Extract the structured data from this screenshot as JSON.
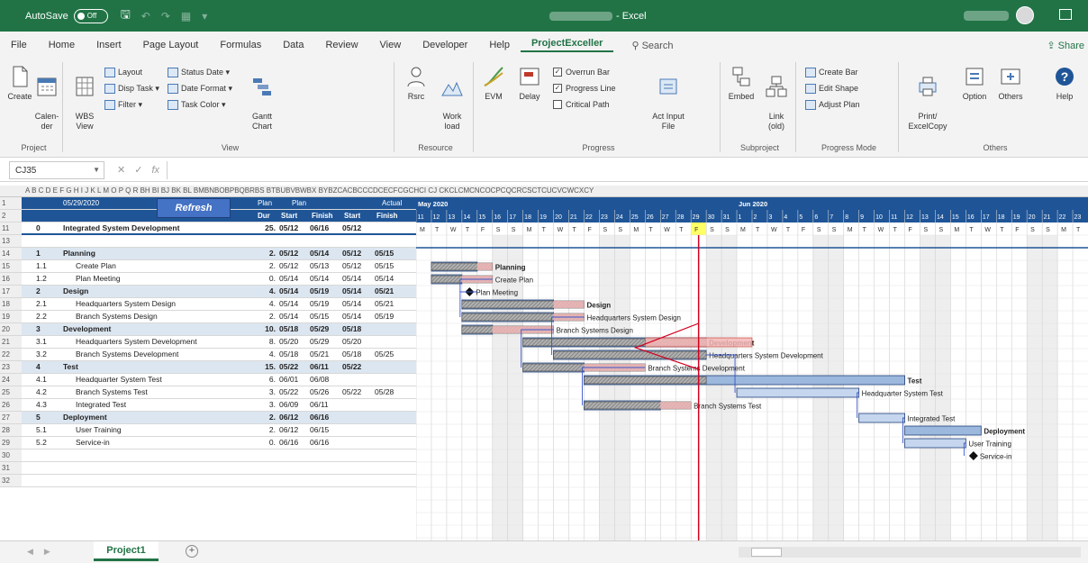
{
  "titlebar": {
    "autosave_label": "AutoSave",
    "autosave_state": "Off",
    "app_name": "- Excel"
  },
  "tabs": [
    "File",
    "Home",
    "Insert",
    "Page Layout",
    "Formulas",
    "Data",
    "Review",
    "View",
    "Developer",
    "Help",
    "ProjectExceller"
  ],
  "active_tab": "ProjectExceller",
  "search_label": "Search",
  "share_label": "Share",
  "ribbon": {
    "project": {
      "label": "Project",
      "create": "Create",
      "calendar": "Calen-\nder"
    },
    "view": {
      "label": "View",
      "wbs": "WBS\nView",
      "layout": "Layout",
      "disp_task": "Disp Task",
      "filter": "Filter",
      "status_date": "Status Date",
      "date_format": "Date Format",
      "task_color": "Task Color",
      "gantt_chart": "Gantt\nChart"
    },
    "resource": {
      "label": "Resource",
      "rsrc": "Rsrc",
      "work_load": "Work\nload"
    },
    "progress": {
      "label": "Progress",
      "evm": "EVM",
      "delay": "Delay",
      "overrun_bar": "Overrun Bar",
      "progress_line": "Progress Line",
      "critical_path": "Critical Path",
      "act_input_file": "Act Input\nFile"
    },
    "subproject": {
      "label": "Subproject",
      "embed": "Embed",
      "link": "Link\n(old)"
    },
    "progress_mode": {
      "label": "Progress Mode",
      "create_bar": "Create Bar",
      "edit_shape": "Edit Shape",
      "adjust_plan": "Adjust Plan"
    },
    "others": {
      "label": "Others",
      "print": "Print/\nExcelCopy",
      "option": "Option",
      "others_btn": "Others",
      "help": "Help"
    }
  },
  "formula_bar": {
    "cell_ref": "CJ35",
    "fx": "fx"
  },
  "sheet": {
    "col_headers": "A  B  C D E F G H I J  K          L                        M      O       P       Q       R   BH BI BJ BK BL BMBNBOBPBQBRBS BTBUBVBWBX BYBZCACBCCCDCECFCGCHCI CJ CKCLCMCNCOCPCQCRCSCTCUCVCWCXCY",
    "row_numbers": [
      "1",
      "2",
      "11",
      "13",
      "14",
      "15",
      "16",
      "17",
      "18",
      "19",
      "20",
      "21",
      "22",
      "23",
      "24",
      "25",
      "26",
      "27",
      "28",
      "29",
      "30",
      "31",
      "32"
    ],
    "header": {
      "status_date": "05/29/2020",
      "refresh": "Refresh",
      "plan": "Plan",
      "dur": "Dur",
      "plan_group": "Plan",
      "actual_group": "Actual",
      "start": "Start",
      "finish": "Finish",
      "month1": "May 2020",
      "month2": "Jun 2020"
    },
    "rows": [
      {
        "wbs": "0",
        "task": "Integrated System Development",
        "dur": "25.",
        "ps": "05/12",
        "pf": "06/16",
        "as": "05/12",
        "af": "",
        "kind": "summary"
      },
      {
        "wbs": "",
        "task": "",
        "dur": "",
        "ps": "",
        "pf": "",
        "as": "",
        "af": "",
        "kind": "blank"
      },
      {
        "wbs": "1",
        "task": "Planning",
        "dur": "2.",
        "ps": "05/12",
        "pf": "05/14",
        "as": "05/12",
        "af": "05/15",
        "kind": "lvl1"
      },
      {
        "wbs": "1.1",
        "task": "Create Plan",
        "dur": "2.",
        "ps": "05/12",
        "pf": "05/13",
        "as": "05/12",
        "af": "05/15",
        "kind": "task"
      },
      {
        "wbs": "1.2",
        "task": "Plan Meeting",
        "dur": "0.",
        "ps": "05/14",
        "pf": "05/14",
        "as": "05/14",
        "af": "05/14",
        "kind": "task"
      },
      {
        "wbs": "2",
        "task": "Design",
        "dur": "4.",
        "ps": "05/14",
        "pf": "05/19",
        "as": "05/14",
        "af": "05/21",
        "kind": "lvl1"
      },
      {
        "wbs": "2.1",
        "task": "Headquarters System Design",
        "dur": "4.",
        "ps": "05/14",
        "pf": "05/19",
        "as": "05/14",
        "af": "05/21",
        "kind": "task"
      },
      {
        "wbs": "2.2",
        "task": "Branch Systems Design",
        "dur": "2.",
        "ps": "05/14",
        "pf": "05/15",
        "as": "05/14",
        "af": "05/19",
        "kind": "task"
      },
      {
        "wbs": "3",
        "task": "Development",
        "dur": "10.",
        "ps": "05/18",
        "pf": "05/29",
        "as": "05/18",
        "af": "",
        "kind": "lvl1"
      },
      {
        "wbs": "3.1",
        "task": "Headquarters System Development",
        "dur": "8.",
        "ps": "05/20",
        "pf": "05/29",
        "as": "05/20",
        "af": "",
        "kind": "task"
      },
      {
        "wbs": "3.2",
        "task": "Branch Systems Development",
        "dur": "4.",
        "ps": "05/18",
        "pf": "05/21",
        "as": "05/18",
        "af": "05/25",
        "kind": "task"
      },
      {
        "wbs": "4",
        "task": "Test",
        "dur": "15.",
        "ps": "05/22",
        "pf": "06/11",
        "as": "05/22",
        "af": "",
        "kind": "lvl1"
      },
      {
        "wbs": "4.1",
        "task": "Headquarter System Test",
        "dur": "6.",
        "ps": "06/01",
        "pf": "06/08",
        "as": "",
        "af": "",
        "kind": "task"
      },
      {
        "wbs": "4.2",
        "task": "Branch Systems Test",
        "dur": "3.",
        "ps": "05/22",
        "pf": "05/26",
        "as": "05/22",
        "af": "05/28",
        "kind": "task"
      },
      {
        "wbs": "4.3",
        "task": "Integrated Test",
        "dur": "3.",
        "ps": "06/09",
        "pf": "06/11",
        "as": "",
        "af": "",
        "kind": "task"
      },
      {
        "wbs": "5",
        "task": "Deployment",
        "dur": "2.",
        "ps": "06/12",
        "pf": "06/16",
        "as": "",
        "af": "",
        "kind": "lvl1"
      },
      {
        "wbs": "5.1",
        "task": "User Training",
        "dur": "2.",
        "ps": "06/12",
        "pf": "06/15",
        "as": "",
        "af": "",
        "kind": "task"
      },
      {
        "wbs": "5.2",
        "task": "Service-in",
        "dur": "0.",
        "ps": "06/16",
        "pf": "06/16",
        "as": "",
        "af": "",
        "kind": "task"
      },
      {
        "wbs": "",
        "task": "",
        "dur": "",
        "ps": "",
        "pf": "",
        "as": "",
        "af": "",
        "kind": "blank"
      },
      {
        "wbs": "",
        "task": "",
        "dur": "",
        "ps": "",
        "pf": "",
        "as": "",
        "af": "",
        "kind": "blank"
      },
      {
        "wbs": "",
        "task": "",
        "dur": "",
        "ps": "",
        "pf": "",
        "as": "",
        "af": "",
        "kind": "blank"
      }
    ],
    "gantt": {
      "days": [
        "11",
        "12",
        "13",
        "14",
        "15",
        "16",
        "17",
        "18",
        "19",
        "20",
        "21",
        "22",
        "23",
        "24",
        "25",
        "26",
        "27",
        "28",
        "29",
        "30",
        "31",
        "1",
        "2",
        "3",
        "4",
        "5",
        "6",
        "7",
        "8",
        "9",
        "10",
        "11",
        "12",
        "13",
        "14",
        "15",
        "16",
        "17",
        "18",
        "19",
        "20",
        "21",
        "22",
        "23"
      ],
      "weekdays": [
        "M",
        "T",
        "W",
        "T",
        "F",
        "S",
        "S",
        "M",
        "T",
        "W",
        "T",
        "F",
        "S",
        "S",
        "M",
        "T",
        "W",
        "T",
        "F",
        "S",
        "S",
        "M",
        "T",
        "W",
        "T",
        "F",
        "S",
        "S",
        "M",
        "T",
        "W",
        "T",
        "F",
        "S",
        "S",
        "M",
        "T",
        "W",
        "T",
        "F",
        "S",
        "S",
        "M",
        "T"
      ],
      "today_index": 18,
      "bar_labels": {
        "planning": "Planning",
        "create_plan": "Create Plan",
        "plan_meeting": "Plan Meeting",
        "design": "Design",
        "hq_design": "Headquarters System Design",
        "branch_design": "Branch Systems Design",
        "development": "Development",
        "hq_dev": "Headquarters System Development",
        "branch_dev": "Branch Systems Development",
        "test": "Test",
        "hq_test": "Headquarter System Test",
        "branch_test": "Branch Systems Test",
        "integrated_test": "Integrated Test",
        "deployment": "Deployment",
        "user_training": "User Training",
        "service_in": "Service-in"
      }
    }
  },
  "statusbar": {
    "sheet_tab": "Project1",
    "add_sheet": "+"
  }
}
